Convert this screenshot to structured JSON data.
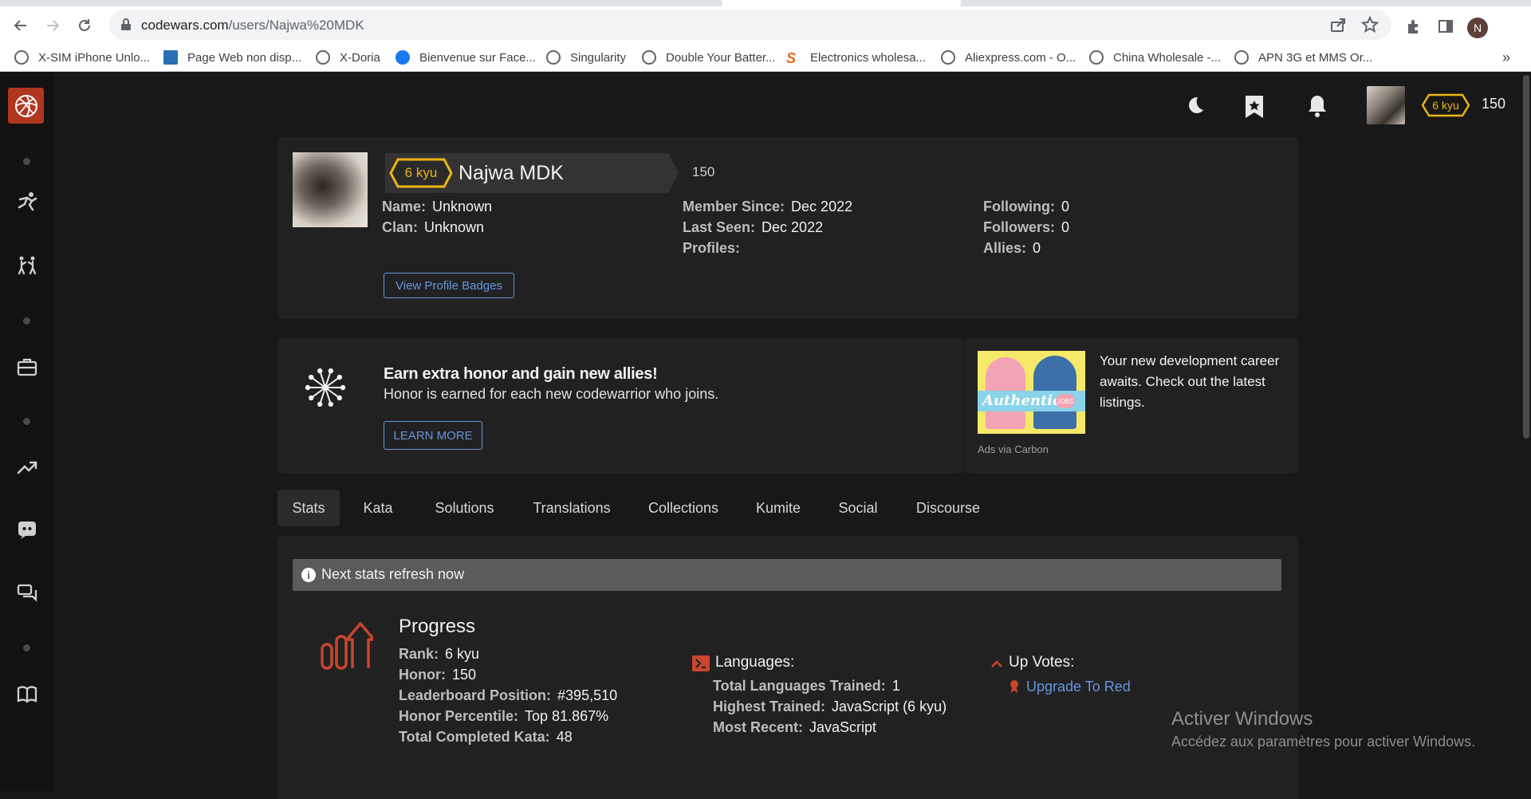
{
  "browser": {
    "url_host": "codewars.com",
    "url_path": "/users/Najwa%20MDK",
    "profile_initial": "N",
    "bookmarks": [
      {
        "label": "X-SIM iPhone Unlo...",
        "icon": "globe-icon"
      },
      {
        "label": "Page Web non disp...",
        "icon": "page-icon"
      },
      {
        "label": "X-Doria",
        "icon": "globe-icon"
      },
      {
        "label": "Bienvenue sur Face...",
        "icon": "facebook-icon"
      },
      {
        "label": "Singularity",
        "icon": "globe-icon"
      },
      {
        "label": "Double Your Batter...",
        "icon": "globe-icon"
      },
      {
        "label": "Electronics wholesa...",
        "icon": "s-brand-icon"
      },
      {
        "label": "Aliexpress.com - O...",
        "icon": "globe-icon"
      },
      {
        "label": "China Wholesale -...",
        "icon": "globe-icon"
      },
      {
        "label": "APN 3G et MMS Or...",
        "icon": "globe-icon"
      }
    ],
    "bookmarks_more": "»"
  },
  "header": {
    "kyu": "6 kyu",
    "honor": "150"
  },
  "profile": {
    "kyu": "6 kyu",
    "username": "Najwa MDK",
    "honor": "150",
    "name_label": "Name:",
    "name_value": "Unknown",
    "clan_label": "Clan:",
    "clan_value": "Unknown",
    "member_since_label": "Member Since:",
    "member_since_value": "Dec 2022",
    "last_seen_label": "Last Seen:",
    "last_seen_value": "Dec 2022",
    "profiles_label": "Profiles:",
    "following_label": "Following:",
    "following_value": "0",
    "followers_label": "Followers:",
    "followers_value": "0",
    "allies_label": "Allies:",
    "allies_value": "0",
    "badges_button": "View Profile Badges"
  },
  "promo": {
    "title": "Earn extra honor and gain new allies!",
    "subtitle": "Honor is earned for each new codewarrior who joins.",
    "button": "LEARN MORE",
    "ad_text": "Your new development career awaits. Check out the latest listings.",
    "ad_image_text": "Authentic",
    "ad_image_badge": "JOBS",
    "ad_source": "Ads via Carbon"
  },
  "tabs": [
    "Stats",
    "Kata",
    "Solutions",
    "Translations",
    "Collections",
    "Kumite",
    "Social",
    "Discourse"
  ],
  "stats": {
    "refresh_notice": "Next stats refresh now",
    "progress_title": "Progress",
    "rank_label": "Rank:",
    "rank_value": "6 kyu",
    "honor_label": "Honor:",
    "honor_value": "150",
    "leaderboard_label": "Leaderboard Position:",
    "leaderboard_value": "#395,510",
    "percentile_label": "Honor Percentile:",
    "percentile_value": "Top 81.867%",
    "completed_label": "Total Completed Kata:",
    "completed_value": "48",
    "languages_title": "Languages:",
    "total_langs_label": "Total Languages Trained:",
    "total_langs_value": "1",
    "highest_label": "Highest Trained:",
    "highest_value": "JavaScript (6 kyu)",
    "recent_label": "Most Recent:",
    "recent_value": "JavaScript",
    "upvotes_title": "Up Votes:",
    "upgrade_link": "Upgrade To Red"
  },
  "watermark": {
    "title": "Activer Windows",
    "subtitle": "Accédez aux paramètres pour activer Windows."
  },
  "colors": {
    "accent_red": "#b1361e",
    "kyu_yellow": "#ecb613",
    "link_blue": "#6795de"
  }
}
